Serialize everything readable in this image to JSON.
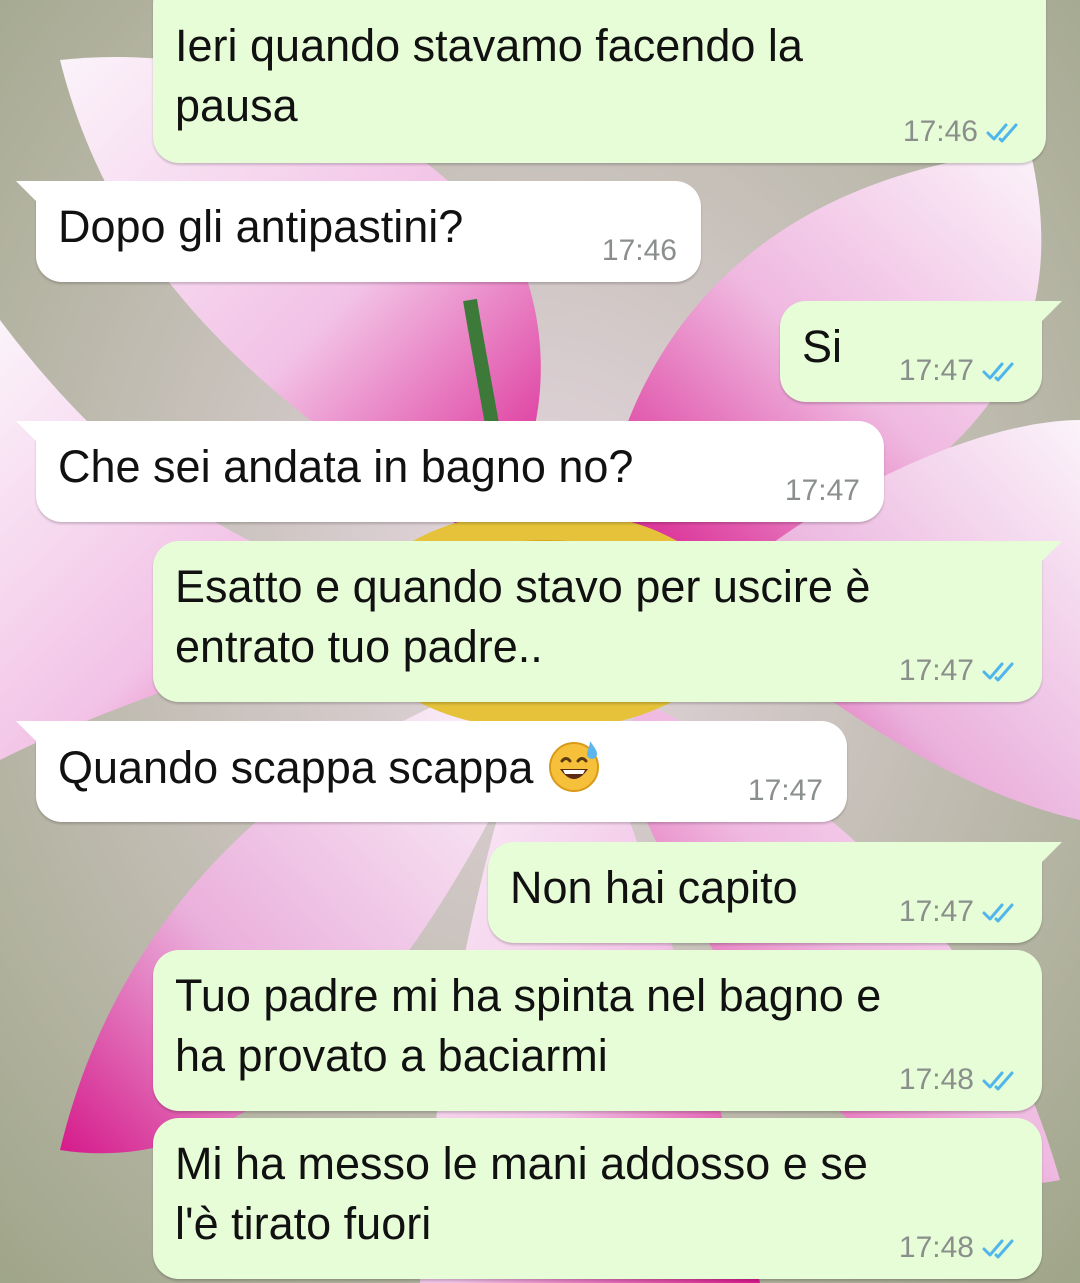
{
  "conversation": {
    "messages": [
      {
        "direction": "outgoing",
        "text": "Ieri quando stavamo facendo la\npausa",
        "time": "17:46",
        "status": "read"
      },
      {
        "direction": "incoming",
        "text": "Dopo gli antipastini?",
        "time": "17:46"
      },
      {
        "direction": "outgoing",
        "text": "Si",
        "time": "17:47",
        "status": "read"
      },
      {
        "direction": "incoming",
        "text": "Che sei andata in bagno no?",
        "time": "17:47"
      },
      {
        "direction": "outgoing",
        "text": "Esatto e quando stavo per uscire è\nentrato tuo padre..",
        "time": "17:47",
        "status": "read"
      },
      {
        "direction": "incoming",
        "text": "Quando scappa scappa",
        "emoji": "grinning-face-with-sweat",
        "time": "17:47"
      },
      {
        "direction": "outgoing",
        "text": "Non hai capito",
        "time": "17:47",
        "status": "read"
      },
      {
        "direction": "outgoing",
        "text": "Tuo padre mi ha spinta nel bagno e\nha provato a baciarmi",
        "time": "17:48",
        "status": "read"
      },
      {
        "direction": "outgoing",
        "text": "Mi ha messo le mani addosso e se\nl'è tirato fuori",
        "time": "17:48",
        "status": "read"
      }
    ]
  },
  "colors": {
    "outgoing_bubble": "#e7fdd8",
    "incoming_bubble": "#ffffff",
    "read_ticks": "#4fb6ec",
    "timestamp": "#8a8f8c",
    "wallpaper_petal": "#e8a0d6",
    "wallpaper_center": "#e8c43a"
  },
  "icons": {
    "read_receipt": "double-check-icon",
    "emoji": "grinning-face-with-sweat-emoji"
  }
}
